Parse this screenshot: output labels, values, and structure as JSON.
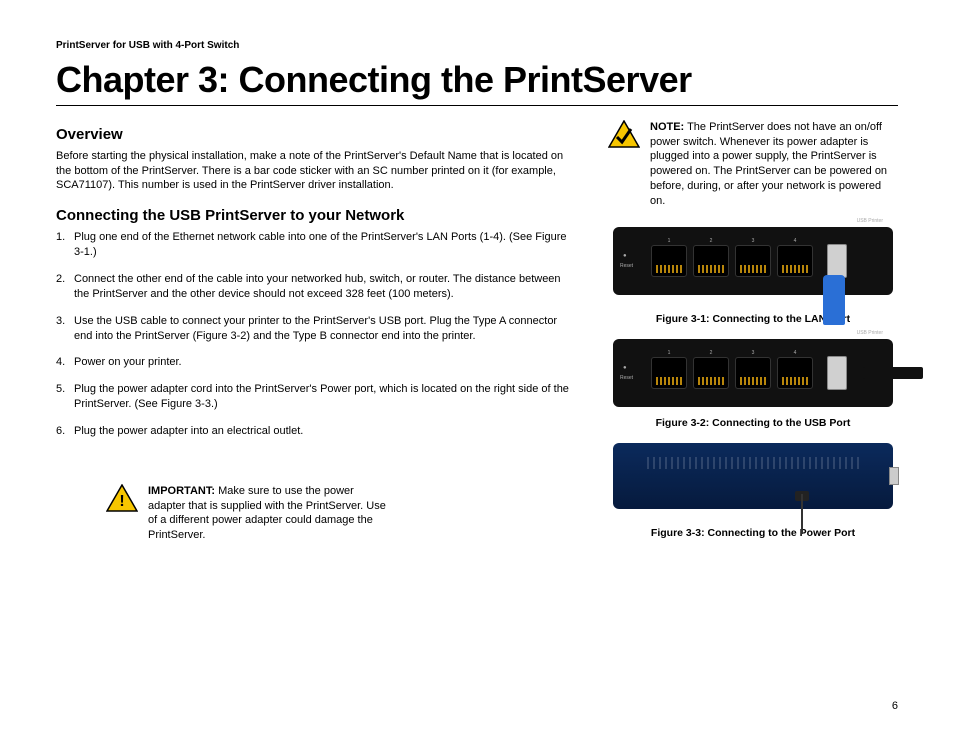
{
  "header": "PrintServer for USB with 4-Port Switch",
  "chapter_title": "Chapter 3: Connecting the PrintServer",
  "overview": {
    "heading": "Overview",
    "text": "Before starting the physical installation, make a note of the PrintServer's Default Name that is located on the bottom of the PrintServer. There is a bar code sticker with an SC number printed on it (for example, SCA71107). This number is used in the PrintServer driver installation."
  },
  "connecting": {
    "heading": "Connecting the USB PrintServer to your Network",
    "steps": [
      "Plug one end of the Ethernet network cable into one of the PrintServer's LAN Ports (1-4). (See Figure 3-1.)",
      "Connect the other end of the cable into your networked hub, switch, or router. The distance between the PrintServer and the other device should not exceed 328 feet (100 meters).",
      "Use the USB cable to connect your printer to the PrintServer's USB port. Plug the Type A connector end into the PrintServer (Figure 3-2) and the Type B connector end into the printer.",
      "Power on your printer.",
      "Plug the power adapter cord into the PrintServer's Power port, which is located on the right side of the PrintServer. (See Figure 3-3.)",
      "Plug the power adapter into an electrical outlet."
    ]
  },
  "important": {
    "label": "IMPORTANT:",
    "text": " Make sure to use the power adapter that is supplied with the PrintServer. Use of a different power adapter could damage the PrintServer."
  },
  "note": {
    "label": "NOTE:",
    "text": " The PrintServer does not have an on/off power switch.  Whenever its power adapter is plugged into a power supply, the PrintServer is powered on. The PrintServer can be powered on before, during, or after your network is powered on."
  },
  "figures": {
    "f1": "Figure 3-1: Connecting to the LAN Port",
    "f2": "Figure 3-2: Connecting to the USB Port",
    "f3": "Figure 3-3: Connecting to the Power Port"
  },
  "port_labels": {
    "reset": "Reset",
    "p1": "1",
    "p2": "2",
    "p3": "3",
    "p4": "4",
    "usb": "USB Printer"
  },
  "page_number": "6"
}
